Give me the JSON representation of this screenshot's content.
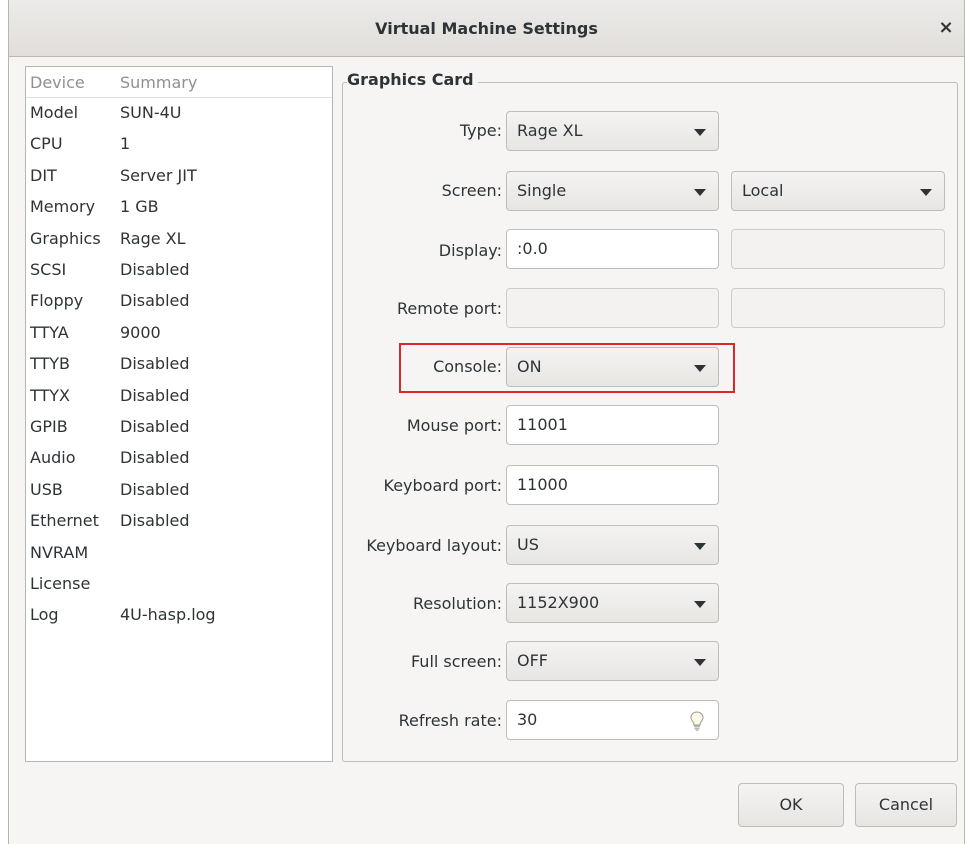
{
  "window": {
    "title": "Virtual Machine Settings",
    "close_glyph": "×"
  },
  "device_list": {
    "headers": [
      "Device",
      "Summary"
    ],
    "rows": [
      {
        "device": "Model",
        "summary": "SUN-4U"
      },
      {
        "device": "CPU",
        "summary": "1"
      },
      {
        "device": "DIT",
        "summary": "Server JIT"
      },
      {
        "device": "Memory",
        "summary": "1 GB"
      },
      {
        "device": "Graphics",
        "summary": "Rage XL"
      },
      {
        "device": "SCSI",
        "summary": "Disabled"
      },
      {
        "device": "Floppy",
        "summary": "Disabled"
      },
      {
        "device": "TTYA",
        "summary": "9000"
      },
      {
        "device": "TTYB",
        "summary": "Disabled"
      },
      {
        "device": "TTYX",
        "summary": "Disabled"
      },
      {
        "device": "GPIB",
        "summary": "Disabled"
      },
      {
        "device": "Audio",
        "summary": "Disabled"
      },
      {
        "device": "USB",
        "summary": "Disabled"
      },
      {
        "device": "Ethernet",
        "summary": "Disabled"
      },
      {
        "device": "NVRAM",
        "summary": ""
      },
      {
        "device": "License",
        "summary": ""
      },
      {
        "device": "Log",
        "summary": "4U-hasp.log"
      }
    ]
  },
  "graphics_card": {
    "title": "Graphics Card",
    "type": {
      "label": "Type:",
      "value": "Rage XL"
    },
    "screen": {
      "label": "Screen:",
      "value": "Single",
      "mode": "Local"
    },
    "display": {
      "label": "Display:",
      "value": ":0.0",
      "extra": ""
    },
    "remote_port": {
      "label": "Remote port:",
      "value": "",
      "extra": ""
    },
    "console": {
      "label": "Console:",
      "value": "ON"
    },
    "mouse_port": {
      "label": "Mouse port:",
      "value": "11001"
    },
    "keyboard_port": {
      "label": "Keyboard port:",
      "value": "11000"
    },
    "keyboard_layout": {
      "label": "Keyboard layout:",
      "value": "US"
    },
    "resolution": {
      "label": "Resolution:",
      "value": "1152X900"
    },
    "full_screen": {
      "label": "Full screen:",
      "value": "OFF"
    },
    "refresh_rate": {
      "label": "Refresh rate:",
      "value": "30",
      "icon": "lightbulb-icon"
    }
  },
  "buttons": {
    "ok": "OK",
    "cancel": "Cancel"
  },
  "colors": {
    "highlight": "#d92929"
  }
}
